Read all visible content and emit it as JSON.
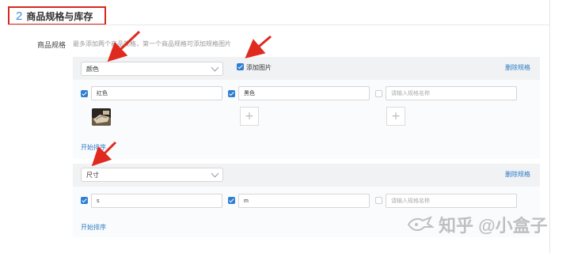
{
  "section": {
    "number": "2",
    "title": "商品规格与库存"
  },
  "specs_field": {
    "label": "商品规格",
    "hint": "最多添加两个商品规格，第一个商品规格可添加规格图片"
  },
  "spec_groups": [
    {
      "name": "颜色",
      "add_image_label": "添加图片",
      "add_image_checked": true,
      "delete_label": "删除规格",
      "values": [
        {
          "value": "红色",
          "checked": true,
          "has_image": true
        },
        {
          "value": "黑色",
          "checked": true,
          "has_image": false
        }
      ],
      "new_value_placeholder": "请输入规格名称",
      "sort_label": "开始排序"
    },
    {
      "name": "尺寸",
      "delete_label": "删除规格",
      "values": [
        {
          "value": "s",
          "checked": true
        },
        {
          "value": "m",
          "checked": true
        }
      ],
      "new_value_placeholder": "请输入规格名称",
      "sort_label": "开始排序"
    }
  ],
  "watermark": {
    "text": "知乎 @小盒子"
  },
  "colors": {
    "accent": "#2f7fd1",
    "annotation_red": "#d9261c",
    "header_bg": "#f1f2f4"
  }
}
